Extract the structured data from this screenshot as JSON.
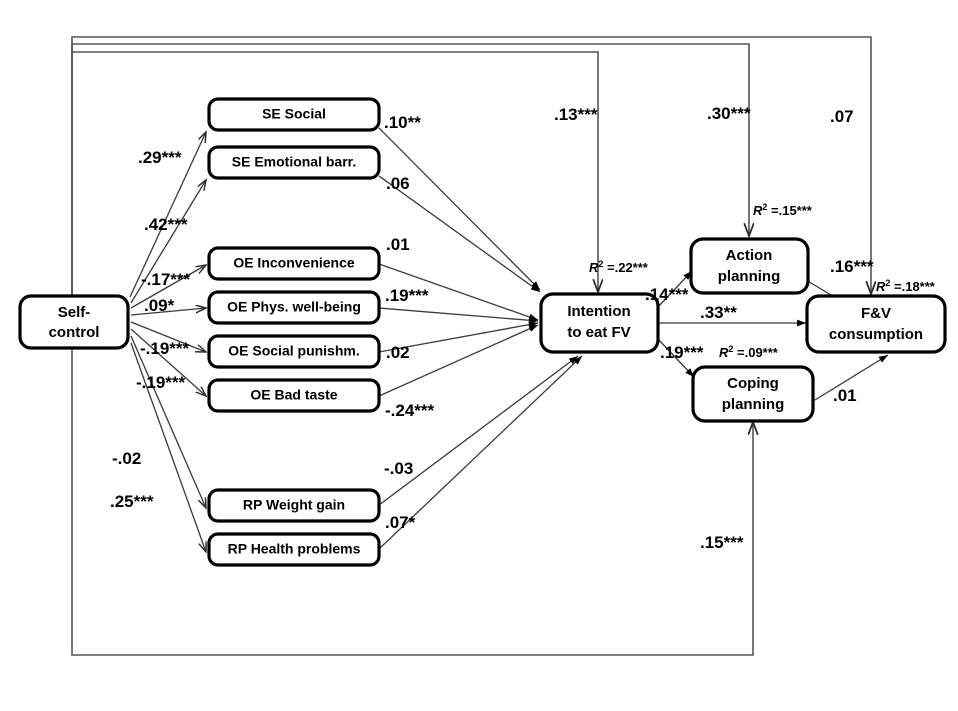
{
  "figure": {
    "type": "path-analysis-structural-equation-model",
    "title": ""
  },
  "nodes": {
    "self_control": {
      "label_line1": "Self-",
      "label_line2": "control"
    },
    "se_social": {
      "label": "SE Social"
    },
    "se_emotional": {
      "label": "SE Emotional barr."
    },
    "oe_inconvenience": {
      "label": "OE Inconvenience"
    },
    "oe_phys": {
      "label": "OE Phys. well-being"
    },
    "oe_social_punish": {
      "label": "OE Social punishm."
    },
    "oe_bad_taste": {
      "label": "OE Bad taste"
    },
    "rp_weight": {
      "label": "RP Weight gain"
    },
    "rp_health": {
      "label": "RP Health problems"
    },
    "intention": {
      "label_line1": "Intention",
      "label_line2": "to eat FV"
    },
    "action_planning": {
      "label_line1": "Action",
      "label_line2": "planning"
    },
    "coping_planning": {
      "label_line1": "Coping",
      "label_line2": "planning"
    },
    "fv_consumption": {
      "label_line1": "F&V",
      "label_line2": "consumption"
    }
  },
  "path_coefficients": {
    "sc_to_se_social": ".29***",
    "sc_to_se_emotional": ".42***",
    "sc_to_oe_inconv": "-.17***",
    "sc_to_oe_phys": ".09*",
    "sc_to_oe_social_punish": "-.19***",
    "sc_to_oe_bad_taste": "-.19***",
    "sc_to_rp_weight": "-.02",
    "sc_to_rp_health": ".25***",
    "se_social_to_int": ".10**",
    "se_emotional_to_int": ".06",
    "oe_inconv_to_int": ".01",
    "oe_phys_to_int": ".19***",
    "oe_social_punish_to_int": ".02",
    "oe_bad_taste_to_int": "-.24***",
    "rp_weight_to_int": "-.03",
    "rp_health_to_int": ".07*",
    "sc_to_intention": ".13***",
    "sc_to_action_planning": ".30***",
    "sc_to_fv_consumption": ".07",
    "sc_to_coping_planning": ".15***",
    "int_to_action_planning": ".14***",
    "int_to_fv": ".33**",
    "int_to_coping_planning": ".19***",
    "action_planning_to_fv": ".16***",
    "coping_planning_to_fv": ".01"
  },
  "r_squared": {
    "intention": {
      "prefix": "R",
      "sup": "2",
      "value": " =.22***"
    },
    "action_planning": {
      "prefix": "R",
      "sup": "2",
      "value": " =.15***"
    },
    "coping_planning": {
      "prefix": "R",
      "sup": "2",
      "value": " =.09***"
    },
    "fv_consumption": {
      "prefix": "R",
      "sup": "2",
      "value": " =.18***"
    }
  }
}
